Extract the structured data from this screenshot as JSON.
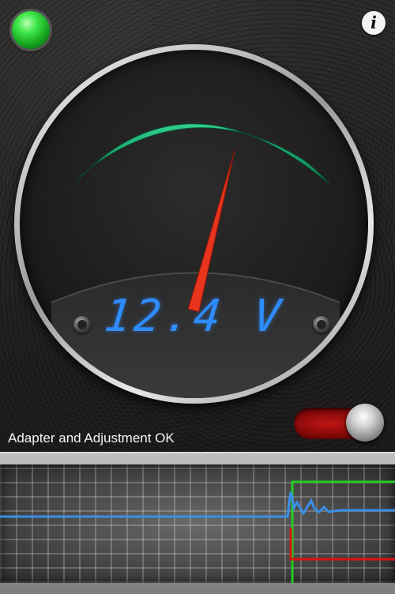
{
  "indicator": {
    "color": "#3fe84a",
    "icon": "green-led-icon"
  },
  "info": {
    "label": "i",
    "icon": "info-icon"
  },
  "gauge": {
    "readout_value": "12.4",
    "readout_unit": "V",
    "green_band_color": "#17a870",
    "needle_color": "#e8341c",
    "needle_level": 0.62
  },
  "toggle": {
    "state": "on",
    "color": "#c11616"
  },
  "status": {
    "message": "Adapter and Adjustment OK"
  },
  "scope": {
    "trace_colors": {
      "signal": "#3a8fe8",
      "upper": "#22cc22",
      "lower": "#dd1111"
    }
  }
}
